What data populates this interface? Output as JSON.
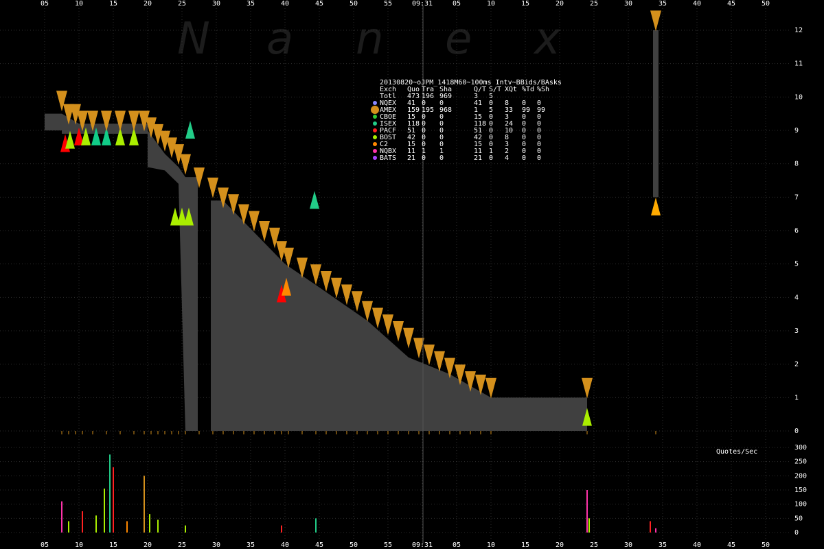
{
  "watermark": [
    "N",
    "a",
    "n",
    "e",
    "x"
  ],
  "time_marker": "09:31",
  "chart_data": {
    "type": "area",
    "title": "20130820~oJPM_1418M60~100ms Intv~BBids/BAsks",
    "x_tick_labels": [
      "05",
      "10",
      "15",
      "20",
      "25",
      "30",
      "35",
      "40",
      "45",
      "50",
      "55",
      "09:31",
      "05",
      "10",
      "15",
      "20",
      "25",
      "30",
      "35",
      "40",
      "45",
      "50"
    ],
    "price_axis": {
      "ticks": [
        "12",
        "11",
        "10",
        "9",
        "8",
        "7",
        "6",
        "5",
        "4",
        "3",
        "2",
        "1",
        "0"
      ],
      "ylim": [
        0,
        12.4
      ]
    },
    "volume_axis": {
      "label": "Quotes/Sec",
      "ticks": [
        "300",
        "250",
        "200",
        "150",
        "100",
        "50",
        "0"
      ],
      "ylim": [
        0,
        300
      ]
    },
    "bid_ask_spread": [
      {
        "t": 5,
        "bid": 9.0,
        "ask": 9.5
      },
      {
        "t": 7.5,
        "bid": 9.0,
        "ask": 9.5
      },
      {
        "t": 7.5,
        "bid": 8.9,
        "ask": 9.5
      },
      {
        "t": 10,
        "bid": 8.9,
        "ask": 9.2
      },
      {
        "t": 20,
        "bid": 8.9,
        "ask": 9.2
      },
      {
        "t": 20,
        "bid": 7.9,
        "ask": 9.0
      },
      {
        "t": 22.5,
        "bid": 7.8,
        "ask": 8.3
      },
      {
        "t": 24.5,
        "bid": 7.4,
        "ask": 7.9
      },
      {
        "t": 25.5,
        "bid": 0.0,
        "ask": 7.6
      },
      {
        "t": 27.3,
        "bid": 0.0,
        "ask": 7.6
      },
      {
        "t": 27.3,
        "bid": 0.0,
        "ask": 0.0
      },
      {
        "t": 29.2,
        "bid": 0.0,
        "ask": 0.0
      },
      {
        "t": 29.2,
        "bid": 0.0,
        "ask": 6.9
      },
      {
        "t": 31,
        "bid": 0.0,
        "ask": 6.9
      },
      {
        "t": 40,
        "bid": 0.0,
        "ask": 5.0
      },
      {
        "t": 45,
        "bid": 0.0,
        "ask": 4.3
      },
      {
        "t": 52,
        "bid": 0.0,
        "ask": 3.3
      },
      {
        "t": 58,
        "bid": 0.0,
        "ask": 2.2
      },
      {
        "t": 64,
        "bid": 0.0,
        "ask": 1.7
      },
      {
        "t": 70,
        "bid": 0.0,
        "ask": 1.0
      },
      {
        "t": 84,
        "bid": 0.0,
        "ask": 1.0
      }
    ],
    "post_gap_spread": [
      {
        "t": 94,
        "bid": 7.0,
        "ask": 12.0
      }
    ],
    "ask_markers": [
      {
        "t": 7.5,
        "price": 9.9
      },
      {
        "t": 8.5,
        "price": 9.5
      },
      {
        "t": 9.5,
        "price": 9.5
      },
      {
        "t": 10.5,
        "price": 9.3
      },
      {
        "t": 12,
        "price": 9.3
      },
      {
        "t": 14,
        "price": 9.3
      },
      {
        "t": 16,
        "price": 9.3
      },
      {
        "t": 18,
        "price": 9.3
      },
      {
        "t": 19.5,
        "price": 9.3
      },
      {
        "t": 20.5,
        "price": 9.1
      },
      {
        "t": 21.5,
        "price": 8.9
      },
      {
        "t": 22.5,
        "price": 8.7
      },
      {
        "t": 23.5,
        "price": 8.5
      },
      {
        "t": 24.5,
        "price": 8.3
      },
      {
        "t": 25.5,
        "price": 8.0
      },
      {
        "t": 27.5,
        "price": 7.6
      },
      {
        "t": 29.5,
        "price": 7.3
      },
      {
        "t": 31,
        "price": 7.0
      },
      {
        "t": 32.5,
        "price": 6.8
      },
      {
        "t": 34,
        "price": 6.5
      },
      {
        "t": 35.5,
        "price": 6.3
      },
      {
        "t": 37,
        "price": 6.0
      },
      {
        "t": 38.5,
        "price": 5.8
      },
      {
        "t": 39.5,
        "price": 5.4
      },
      {
        "t": 40.5,
        "price": 5.2
      },
      {
        "t": 42.5,
        "price": 4.9
      },
      {
        "t": 44.5,
        "price": 4.7
      },
      {
        "t": 46,
        "price": 4.5
      },
      {
        "t": 47.5,
        "price": 4.3
      },
      {
        "t": 49,
        "price": 4.1
      },
      {
        "t": 50.5,
        "price": 3.9
      },
      {
        "t": 52,
        "price": 3.6
      },
      {
        "t": 53.5,
        "price": 3.4
      },
      {
        "t": 55,
        "price": 3.2
      },
      {
        "t": 56.5,
        "price": 3.0
      },
      {
        "t": 58,
        "price": 2.8
      },
      {
        "t": 59.5,
        "price": 2.5
      },
      {
        "t": 61,
        "price": 2.3
      },
      {
        "t": 62.5,
        "price": 2.1
      },
      {
        "t": 64,
        "price": 1.9
      },
      {
        "t": 65.5,
        "price": 1.7
      },
      {
        "t": 67,
        "price": 1.5
      },
      {
        "t": 68.5,
        "price": 1.4
      },
      {
        "t": 70,
        "price": 1.3
      },
      {
        "t": 84,
        "price": 1.3
      },
      {
        "t": 94,
        "price": 12.3
      }
    ],
    "bid_markers": [
      {
        "t": 8,
        "price": 8.6,
        "color": "#ff0000"
      },
      {
        "t": 8.7,
        "price": 8.7,
        "color": "#aaee00"
      },
      {
        "t": 10,
        "price": 8.8,
        "color": "#ff0000"
      },
      {
        "t": 11,
        "price": 8.8,
        "color": "#aaee00"
      },
      {
        "t": 12.5,
        "price": 8.8,
        "color": "#11cc88"
      },
      {
        "t": 14,
        "price": 8.8,
        "color": "#11cc88"
      },
      {
        "t": 16,
        "price": 8.8,
        "color": "#aaee00"
      },
      {
        "t": 18,
        "price": 8.8,
        "color": "#aaee00"
      },
      {
        "t": 24,
        "price": 6.4,
        "color": "#aaee00"
      },
      {
        "t": 25,
        "price": 6.4,
        "color": "#aaee00"
      },
      {
        "t": 26,
        "price": 6.4,
        "color": "#aaee00"
      },
      {
        "t": 26.2,
        "price": 9.0,
        "color": "#22cc88"
      },
      {
        "t": 39.5,
        "price": 4.1,
        "color": "#ff0000"
      },
      {
        "t": 40.2,
        "price": 4.3,
        "color": "#ff8800"
      },
      {
        "t": 44.3,
        "price": 6.9,
        "color": "#22cc88"
      },
      {
        "t": 84,
        "price": 0.4,
        "color": "#aaee00"
      },
      {
        "t": 94,
        "price": 6.7,
        "color": "#ffaa00"
      }
    ],
    "exchange_table": {
      "columns": [
        "Exch",
        "Quo",
        "Tra",
        "Sha",
        "Q/T",
        "S/T",
        "XQt",
        "%Td",
        "%Sh"
      ],
      "total": [
        "Totl",
        "473",
        "196",
        "969",
        "3",
        "5"
      ],
      "rows": [
        {
          "exch": "NQEX",
          "quo": "41",
          "tra": "0",
          "sha": "0",
          "qt": "41",
          "st": "0",
          "xqt": "8",
          "td": "0",
          "sh": "0",
          "color": "#8888ff"
        },
        {
          "exch": "AMEX",
          "quo": "159",
          "tra": "195",
          "sha": "968",
          "qt": "1",
          "st": "5",
          "xqt": "33",
          "td": "99",
          "sh": "99",
          "color": "#d4901c"
        },
        {
          "exch": "CBOE",
          "quo": "15",
          "tra": "0",
          "sha": "0",
          "qt": "15",
          "st": "0",
          "xqt": "3",
          "td": "0",
          "sh": "0",
          "color": "#33cc33"
        },
        {
          "exch": "ISEX",
          "quo": "118",
          "tra": "0",
          "sha": "0",
          "qt": "118",
          "st": "0",
          "xqt": "24",
          "td": "0",
          "sh": "0",
          "color": "#22cc88"
        },
        {
          "exch": "PACF",
          "quo": "51",
          "tra": "0",
          "sha": "0",
          "qt": "51",
          "st": "0",
          "xqt": "10",
          "td": "0",
          "sh": "0",
          "color": "#ff2222"
        },
        {
          "exch": "BOST",
          "quo": "42",
          "tra": "0",
          "sha": "0",
          "qt": "42",
          "st": "0",
          "xqt": "8",
          "td": "0",
          "sh": "0",
          "color": "#aaee00"
        },
        {
          "exch": "C2",
          "quo": "15",
          "tra": "0",
          "sha": "0",
          "qt": "15",
          "st": "0",
          "xqt": "3",
          "td": "0",
          "sh": "0",
          "color": "#ff8800"
        },
        {
          "exch": "NQBX",
          "quo": "11",
          "tra": "1",
          "sha": "1",
          "qt": "11",
          "st": "1",
          "xqt": "2",
          "td": "0",
          "sh": "0",
          "color": "#ff33aa"
        },
        {
          "exch": "BATS",
          "quo": "21",
          "tra": "0",
          "sha": "0",
          "qt": "21",
          "st": "0",
          "xqt": "4",
          "td": "0",
          "sh": "0",
          "color": "#aa44ff"
        }
      ]
    },
    "quote_rate_spikes": [
      {
        "t": 7.5,
        "value": 110,
        "color": "#ff33aa"
      },
      {
        "t": 8.5,
        "value": 40,
        "color": "#aaee00"
      },
      {
        "t": 10.5,
        "value": 75,
        "color": "#ff2222"
      },
      {
        "t": 12.5,
        "value": 60,
        "color": "#aaee00"
      },
      {
        "t": 14.5,
        "value": 275,
        "color": "#22cc88"
      },
      {
        "t": 15,
        "value": 230,
        "color": "#ff2222"
      },
      {
        "t": 13.7,
        "value": 155,
        "color": "#aaee00"
      },
      {
        "t": 17,
        "value": 40,
        "color": "#ff8800"
      },
      {
        "t": 19.5,
        "value": 200,
        "color": "#d4901c"
      },
      {
        "t": 20.3,
        "value": 65,
        "color": "#aaee00"
      },
      {
        "t": 21.5,
        "value": 45,
        "color": "#aaee00"
      },
      {
        "t": 25.5,
        "value": 25,
        "color": "#aaee00"
      },
      {
        "t": 39.5,
        "value": 25,
        "color": "#ff2222"
      },
      {
        "t": 44.5,
        "value": 50,
        "color": "#22cc88"
      },
      {
        "t": 84,
        "value": 150,
        "color": "#ff33aa"
      },
      {
        "t": 84.3,
        "value": 50,
        "color": "#aaee00"
      },
      {
        "t": 93.2,
        "value": 40,
        "color": "#ff2222"
      },
      {
        "t": 94,
        "value": 15,
        "color": "#ff33aa"
      }
    ]
  },
  "colors": {
    "background": "#000000",
    "spread_fill": "#404040",
    "ask_marker": "#d4901c",
    "grid": "#2e2e2e",
    "time_line": "#666666"
  }
}
